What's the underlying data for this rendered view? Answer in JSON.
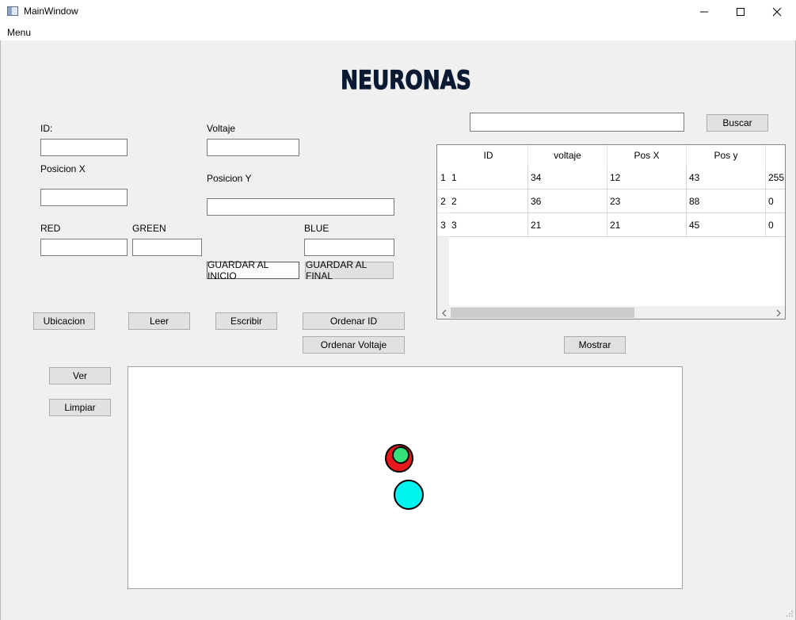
{
  "window": {
    "title": "MainWindow"
  },
  "menu": {
    "label": "Menu"
  },
  "heading": "NEURONAS",
  "form": {
    "id_label": "ID:",
    "voltaje_label": "Voltaje",
    "posx_label": "Posicion X",
    "posy_label": "Posicion Y",
    "red_label": "RED",
    "green_label": "GREEN",
    "blue_label": "BLUE",
    "id_value": "",
    "voltaje_value": "",
    "posx_value": "",
    "posy_value": "",
    "red_value": "",
    "green_value": "",
    "blue_value": ""
  },
  "buttons": {
    "guardar_inicio": "GUARDAR AL INICIO",
    "guardar_final": "GUARDAR AL FINAL",
    "ubicacion": "Ubicacion",
    "leer": "Leer",
    "escribir": "Escribir",
    "ordenar_id": "Ordenar ID",
    "ordenar_voltaje": "Ordenar Voltaje",
    "mostrar": "Mostrar",
    "buscar": "Buscar",
    "ver": "Ver",
    "limpiar": "Limpiar"
  },
  "search": {
    "value": ""
  },
  "table": {
    "columns": [
      "ID",
      "voltaje",
      "Pos X",
      "Pos y"
    ],
    "rows": [
      {
        "num": "1",
        "cells": [
          "1",
          "34",
          "12",
          "43",
          "255"
        ]
      },
      {
        "num": "2",
        "cells": [
          "2",
          "36",
          "23",
          "88",
          "0"
        ]
      },
      {
        "num": "3",
        "cells": [
          "3",
          "21",
          "21",
          "45",
          "0"
        ]
      }
    ]
  },
  "scene": {
    "neurons": [
      {
        "outer": "#e8191c",
        "inner": "#33e07a"
      },
      {
        "outer": "#00f5ee"
      }
    ]
  },
  "icons": {
    "minimize": "minimize-icon",
    "maximize": "maximize-icon",
    "close": "close-icon",
    "scroll_left": "chevron-left-icon",
    "scroll_right": "chevron-right-icon",
    "resize": "resize-grip-icon"
  }
}
